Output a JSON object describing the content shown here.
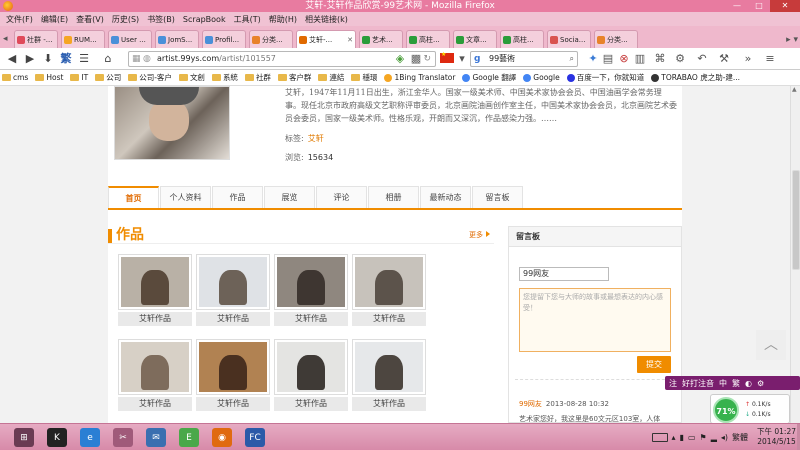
{
  "window": {
    "title": "艾轩-艾轩作品欣赏-99艺术网 - Mozilla Firefox",
    "controls": [
      "—",
      "□",
      "✕"
    ]
  },
  "menu": [
    "文件(F)",
    "编辑(E)",
    "查看(V)",
    "历史(S)",
    "书签(B)",
    "ScrapBook",
    "工具(T)",
    "帮助(H)",
    "相关链接(k)"
  ],
  "tabs": [
    {
      "label": "社群 -...",
      "color": "#e04a5a",
      "active": false
    },
    {
      "label": "RUM...",
      "color": "#f5a623",
      "active": false
    },
    {
      "label": "User ...",
      "color": "#4a90d9",
      "active": false
    },
    {
      "label": "JomS...",
      "color": "#4a90d9",
      "active": false
    },
    {
      "label": "Profil...",
      "color": "#4a90d9",
      "active": false
    },
    {
      "label": "分类...",
      "color": "#e8832a",
      "active": false
    },
    {
      "label": "艾轩-...",
      "color": "#e06a00",
      "active": true
    },
    {
      "label": "艺术...",
      "color": "#2a9d3a",
      "active": false
    },
    {
      "label": "高柱...",
      "color": "#2a9d3a",
      "active": false
    },
    {
      "label": "文章...",
      "color": "#2a9d3a",
      "active": false
    },
    {
      "label": "高柱...",
      "color": "#2a9d3a",
      "active": false
    },
    {
      "label": "Socia...",
      "color": "#d9534f",
      "active": false
    },
    {
      "label": "分类...",
      "color": "#e8832a",
      "active": false
    }
  ],
  "nav": {
    "url_host": "artist.99ys.com",
    "url_path": "/artist/101557",
    "search_value": "99藝術"
  },
  "bookmarks": [
    {
      "label": "cms",
      "type": "folder"
    },
    {
      "label": "Host",
      "type": "folder"
    },
    {
      "label": "IT",
      "type": "folder"
    },
    {
      "label": "公司",
      "type": "folder"
    },
    {
      "label": "公司-客户",
      "type": "folder"
    },
    {
      "label": "文創",
      "type": "folder"
    },
    {
      "label": "系統",
      "type": "folder"
    },
    {
      "label": "社群",
      "type": "folder"
    },
    {
      "label": "客户群",
      "type": "folder"
    },
    {
      "label": "連結",
      "type": "folder"
    },
    {
      "label": "穩環",
      "type": "folder"
    },
    {
      "label": "1Bing Translator",
      "type": "site",
      "color": "#f5a623"
    },
    {
      "label": "Google 翻譯",
      "type": "site",
      "color": "#4285f4"
    },
    {
      "label": "Google",
      "type": "site",
      "color": "#4285f4"
    },
    {
      "label": "百度一下，你就知道",
      "type": "site",
      "color": "#2932e1"
    },
    {
      "label": "TORABAO 虎之助-建...",
      "type": "site",
      "color": "#333333"
    }
  ],
  "artist": {
    "bio": "艾轩，1947年11月11日出生，浙江金华人。国家一级美术师、中国美术家协会会员、中国油画学会常务理事。现任北京市政府高级文艺职称评审委员，北京画院油画创作室主任，中国美术家协会会员，北京画院艺术委员会委员，国家一级美术师。性格乐观，开朗而又深沉，作品感染力强。……",
    "tag_label": "标签:",
    "tag_value": "艾轩",
    "views_label": "浏览:",
    "views_value": "15634"
  },
  "page_tabs": [
    {
      "label": "首页",
      "active": true
    },
    {
      "label": "个人资料",
      "active": false
    },
    {
      "label": "作品",
      "active": false
    },
    {
      "label": "展览",
      "active": false
    },
    {
      "label": "评论",
      "active": false
    },
    {
      "label": "相册",
      "active": false
    },
    {
      "label": "最新动态",
      "active": false
    },
    {
      "label": "留言板",
      "active": false
    }
  ],
  "works": {
    "heading": "作品",
    "more": "更多",
    "items": [
      {
        "caption": "艾轩作品",
        "bg": "#b9b1a6",
        "fig": "#5a4a3c"
      },
      {
        "caption": "艾轩作品",
        "bg": "#dfe2e6",
        "fig": "#6d6258"
      },
      {
        "caption": "艾轩作品",
        "bg": "#8f877f",
        "fig": "#3e3631"
      },
      {
        "caption": "艾轩作品",
        "bg": "#c7c2bb",
        "fig": "#5c534b"
      },
      {
        "caption": "艾轩作品",
        "bg": "#d7d0c6",
        "fig": "#7e6c5c"
      },
      {
        "caption": "艾轩作品",
        "bg": "#b18252",
        "fig": "#4a3020"
      },
      {
        "caption": "艾轩作品",
        "bg": "#e4e4e2",
        "fig": "#3f3a36"
      },
      {
        "caption": "艾轩作品",
        "bg": "#e6e8ea",
        "fig": "#4d4640"
      }
    ]
  },
  "board": {
    "heading": "留言板",
    "name_value": "99网友",
    "placeholder": "您提留下您与大师的故事或最想表达的内心感受！",
    "submit": "提交",
    "entry_user": "99网友",
    "entry_time": "2013-08-28 10:32",
    "entry_text": "艺术家您好，我这里是60文元区103室，人体"
  },
  "ime": {
    "items": [
      "注",
      "好打注音",
      "中",
      "繁",
      "◐",
      "⚙"
    ]
  },
  "netmon": {
    "percent": "71%",
    "up": "0.1K/s",
    "down": "0.1K/s"
  },
  "taskbar": {
    "clock_time": "下午 01:27",
    "clock_date": "2014/5/15",
    "ime_label": "繁體",
    "apps": [
      {
        "name": "start",
        "color": "#6a3b53",
        "glyph": "⊞"
      },
      {
        "name": "kindle",
        "color": "#222222",
        "glyph": "K"
      },
      {
        "name": "ie",
        "color": "#2a7fd4",
        "glyph": "e"
      },
      {
        "name": "tool",
        "color": "#a05a7a",
        "glyph": "✂"
      },
      {
        "name": "thunderbird",
        "color": "#3a6fb0",
        "glyph": "✉"
      },
      {
        "name": "evernote",
        "color": "#4aa84a",
        "glyph": "E"
      },
      {
        "name": "firefox",
        "color": "#e06a10",
        "glyph": "◉"
      },
      {
        "name": "fc",
        "color": "#2b5aa8",
        "glyph": "FC"
      }
    ]
  }
}
